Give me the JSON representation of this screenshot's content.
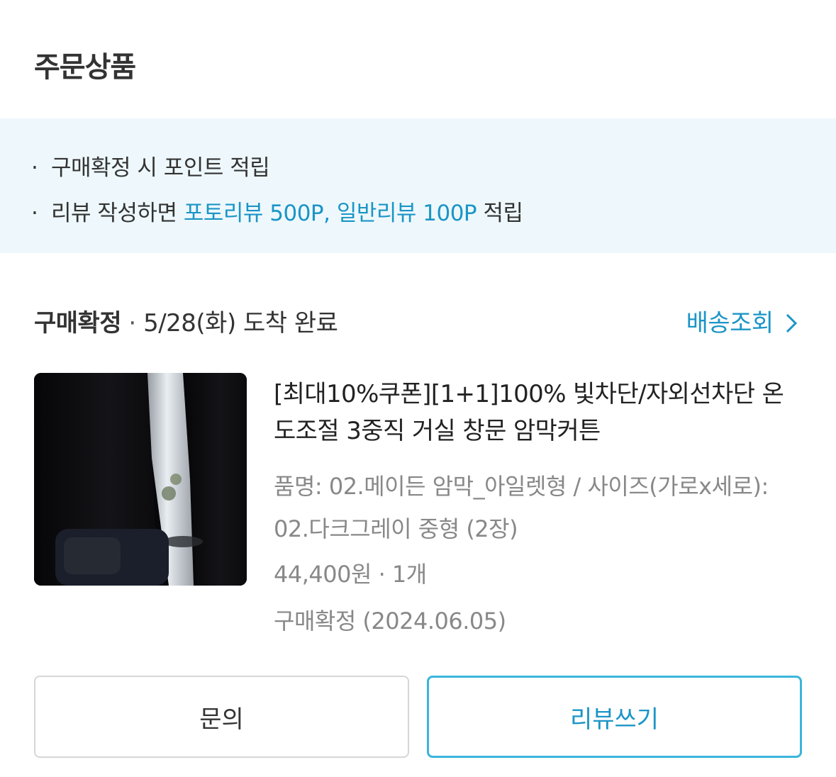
{
  "section": {
    "title": "주문상품"
  },
  "notice": {
    "bullet": "·",
    "line1": "구매확정 시 포인트 적립",
    "line2_prefix": "리뷰 작성하면 ",
    "line2_accent": "포토리뷰 500P, 일반리뷰 100P",
    "line2_suffix": " 적립"
  },
  "status": {
    "label": "구매확정",
    "separator": " · ",
    "detail": "5/28(화) 도착 완료",
    "track_label": "배송조회",
    "track_chevron": "›"
  },
  "product": {
    "image_icon": "curtain-photo",
    "title": "[최대10%쿠폰][1+1]100% 빛차단/자외선차단 온도조절 3중직 거실 창문 암막커튼",
    "option": "품명: 02.메이든 암막_아일렛형 / 사이즈(가로x세로): 02.다크그레이 중형 (2장)",
    "price_qty": "44,400원 · 1개",
    "confirm_text": "구매확정 (2024.06.05)"
  },
  "buttons": {
    "inquiry": "문의",
    "review": "리뷰쓰기"
  },
  "colors": {
    "accent": "#1b95c6",
    "notice_bg": "#eef8fc",
    "review_border": "#3ab5dc"
  }
}
